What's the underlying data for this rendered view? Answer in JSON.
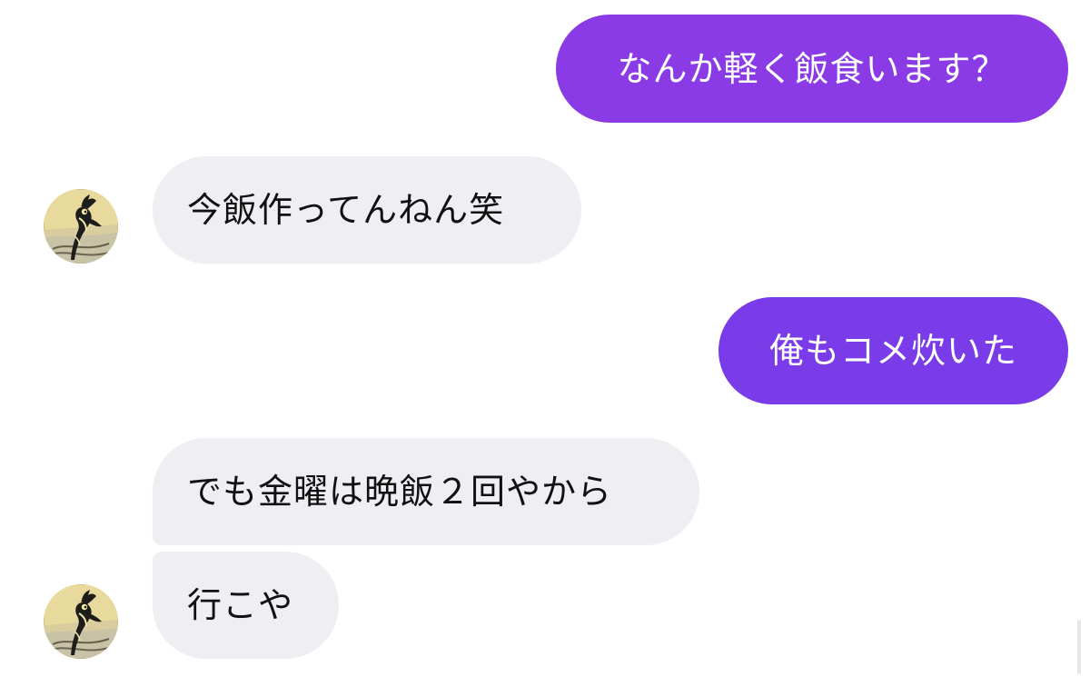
{
  "messages": [
    {
      "id": "sent-1",
      "direction": "outgoing",
      "text": "なんか軽く飯食います？",
      "color": "#8a3be6"
    },
    {
      "id": "recv-1",
      "direction": "incoming",
      "text": "今飯作ってんねん笑",
      "avatar_icon": "cartoon-bird-avatar-icon"
    },
    {
      "id": "sent-2",
      "direction": "outgoing",
      "text": "俺もコメ炊いた",
      "color": "#7a3ce8"
    },
    {
      "id": "recv-2",
      "direction": "incoming",
      "text": "でも金曜は晩飯２回やから"
    },
    {
      "id": "recv-3",
      "direction": "incoming",
      "text": "行こや",
      "avatar_icon": "cartoon-bird-avatar-icon"
    }
  ],
  "theme": {
    "background": "#ffffff",
    "incoming_bubble": "#eeeef3",
    "incoming_text": "#111111",
    "outgoing_text": "#ffffff"
  }
}
